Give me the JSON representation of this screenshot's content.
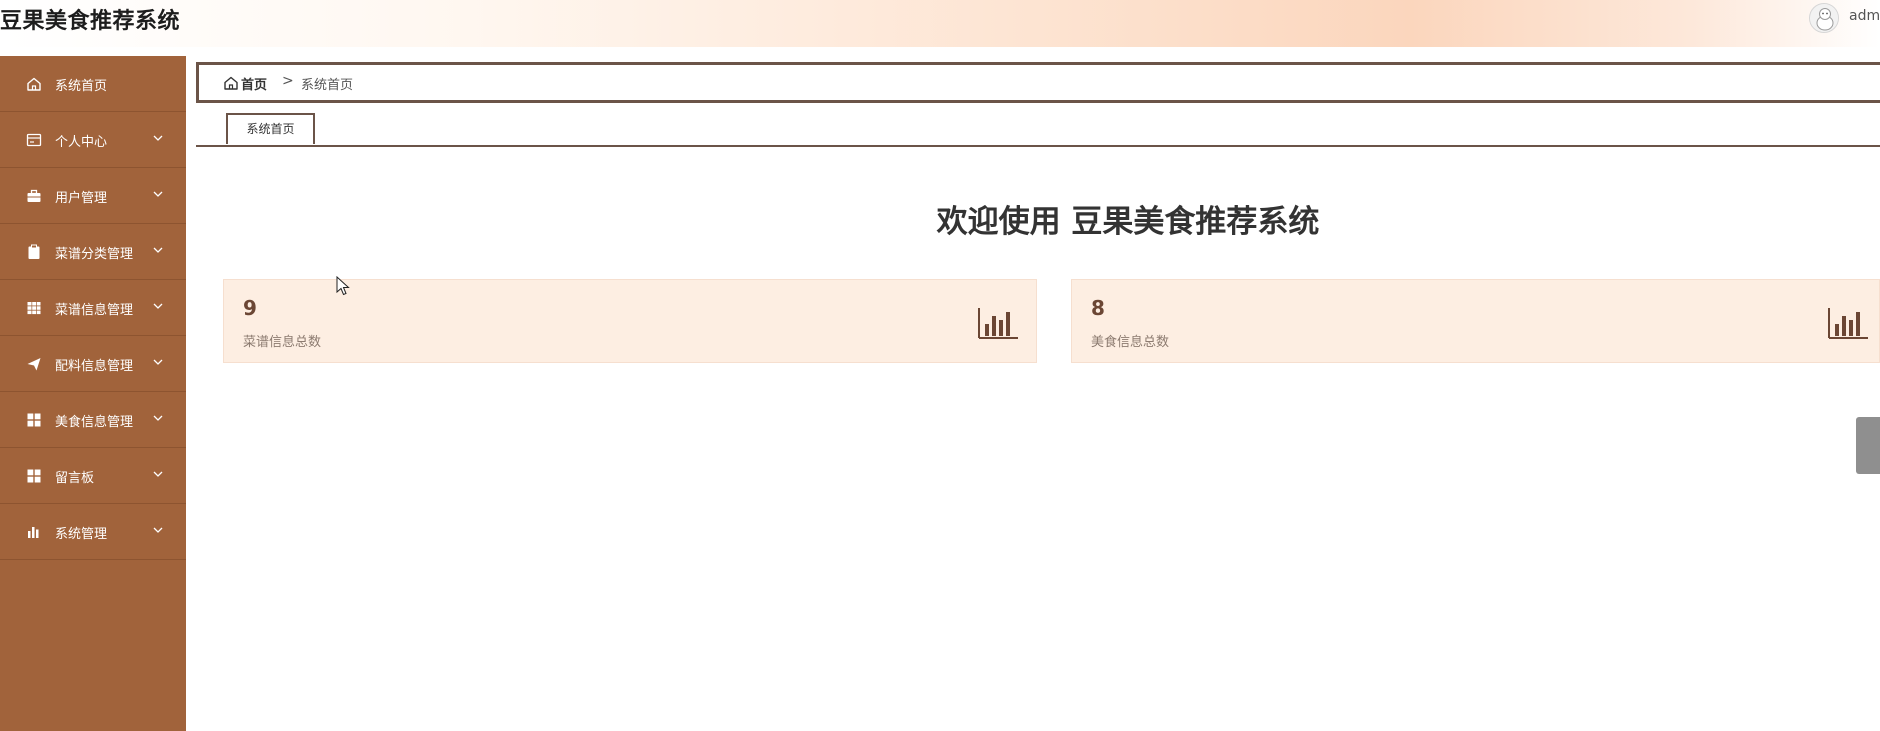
{
  "header": {
    "app_title": "豆果美食推荐系统",
    "username": "adm"
  },
  "sidebar": {
    "items": [
      {
        "label": "系统首页",
        "icon": "home-icon",
        "has_submenu": false
      },
      {
        "label": "个人中心",
        "icon": "card-icon",
        "has_submenu": true
      },
      {
        "label": "用户管理",
        "icon": "briefcase-icon",
        "has_submenu": true
      },
      {
        "label": "菜谱分类管理",
        "icon": "clipboard-icon",
        "has_submenu": true
      },
      {
        "label": "菜谱信息管理",
        "icon": "table-icon",
        "has_submenu": true
      },
      {
        "label": "配料信息管理",
        "icon": "paper-plane-icon",
        "has_submenu": true
      },
      {
        "label": "美食信息管理",
        "icon": "grid-icon",
        "has_submenu": true
      },
      {
        "label": "留言板",
        "icon": "grid-icon",
        "has_submenu": true
      },
      {
        "label": "系统管理",
        "icon": "bar-chart-icon",
        "has_submenu": true
      }
    ]
  },
  "breadcrumb": {
    "home": "首页",
    "separator": ">",
    "current": "系统首页"
  },
  "tabs": [
    {
      "label": "系统首页",
      "active": true
    }
  ],
  "main": {
    "welcome_prefix": "欢迎使用",
    "welcome_name": "豆果美食推荐系统",
    "stats": [
      {
        "value": "9",
        "label": "菜谱信息总数",
        "icon": "bar-chart-icon"
      },
      {
        "value": "8",
        "label": "美食信息总数",
        "icon": "bar-chart-icon"
      }
    ]
  },
  "colors": {
    "sidebar": "#a1633b",
    "accent_border": "#6b5448",
    "card_bg": "#fdeee2",
    "stat_value": "#6b4634"
  }
}
